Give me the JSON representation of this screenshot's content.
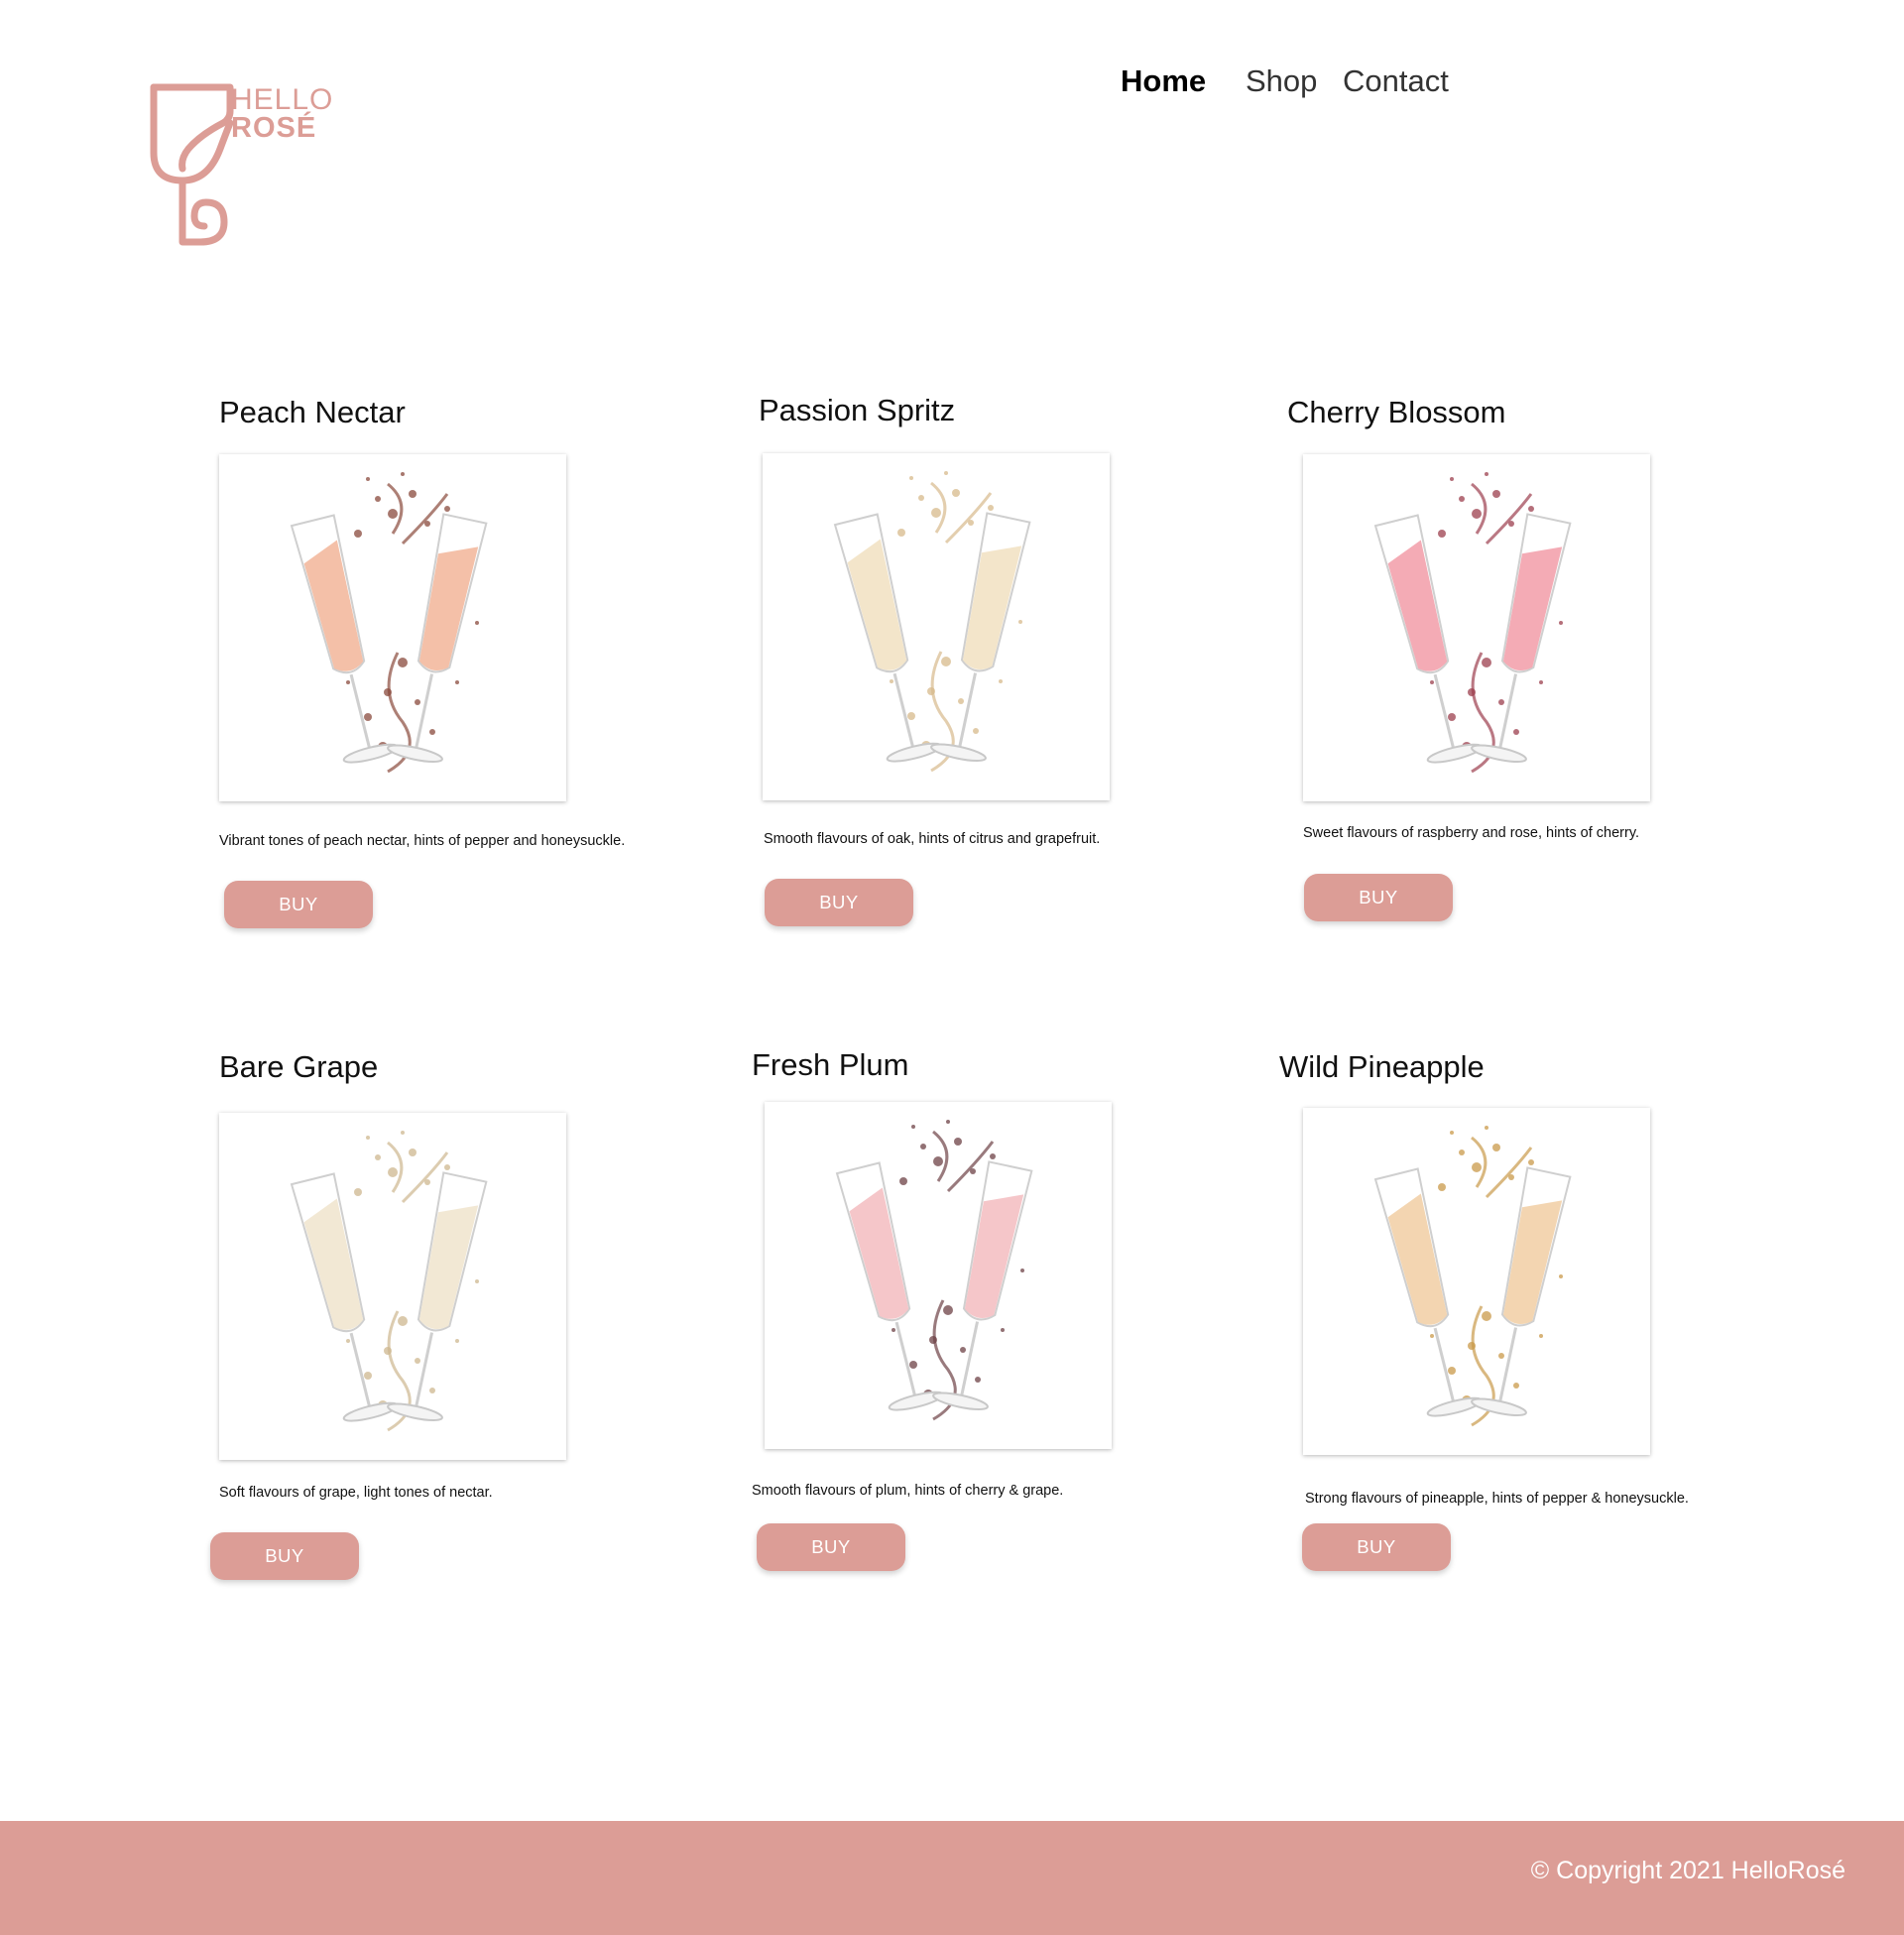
{
  "brand": {
    "name_line1": "HELLO",
    "name_line2": "ROSÉ",
    "color": "#dc9d96",
    "icon": "wine-glass-logo-icon"
  },
  "nav": {
    "items": [
      {
        "label": "Home",
        "active": true
      },
      {
        "label": "Shop",
        "active": false
      },
      {
        "label": "Contact",
        "active": false
      }
    ]
  },
  "products": [
    {
      "name": "Peach Nectar",
      "description": "Vibrant tones of peach nectar, hints of pepper and honeysuckle.",
      "buy_label": "BUY",
      "image_icon": "clinking-glasses-image",
      "tint": "#f3b99f",
      "splash": "#8a4a3c"
    },
    {
      "name": "Passion Spritz",
      "description": "Smooth flavours of oak, hints of citrus and grapefruit.",
      "buy_label": "BUY",
      "image_icon": "clinking-glasses-image",
      "tint": "#f2e2c4",
      "splash": "#d7b98b"
    },
    {
      "name": "Cherry Blossom",
      "description": "Sweet flavours of raspberry and rose, hints of cherry.",
      "buy_label": "BUY",
      "image_icon": "clinking-glasses-image",
      "tint": "#f3a2ad",
      "splash": "#9c3f4e"
    },
    {
      "name": "Bare Grape",
      "description": "Soft flavours of grape, light tones of nectar.",
      "buy_label": "BUY",
      "image_icon": "clinking-glasses-image",
      "tint": "#f1e6cf",
      "splash": "#cdb78f"
    },
    {
      "name": "Fresh Plum",
      "description": "Smooth flavours of plum, hints of cherry & grape.",
      "buy_label": "BUY",
      "image_icon": "clinking-glasses-image",
      "tint": "#f4c0c3",
      "splash": "#6e4246"
    },
    {
      "name": "Wild Pineapple",
      "description": "Strong flavours of pineapple, hints of pepper & honeysuckle.",
      "buy_label": "BUY",
      "image_icon": "clinking-glasses-image",
      "tint": "#f2d0a8",
      "splash": "#c99a4a"
    }
  ],
  "footer": {
    "copyright": "© Copyright 2021 HelloRosé",
    "background": "#dc9d96"
  }
}
